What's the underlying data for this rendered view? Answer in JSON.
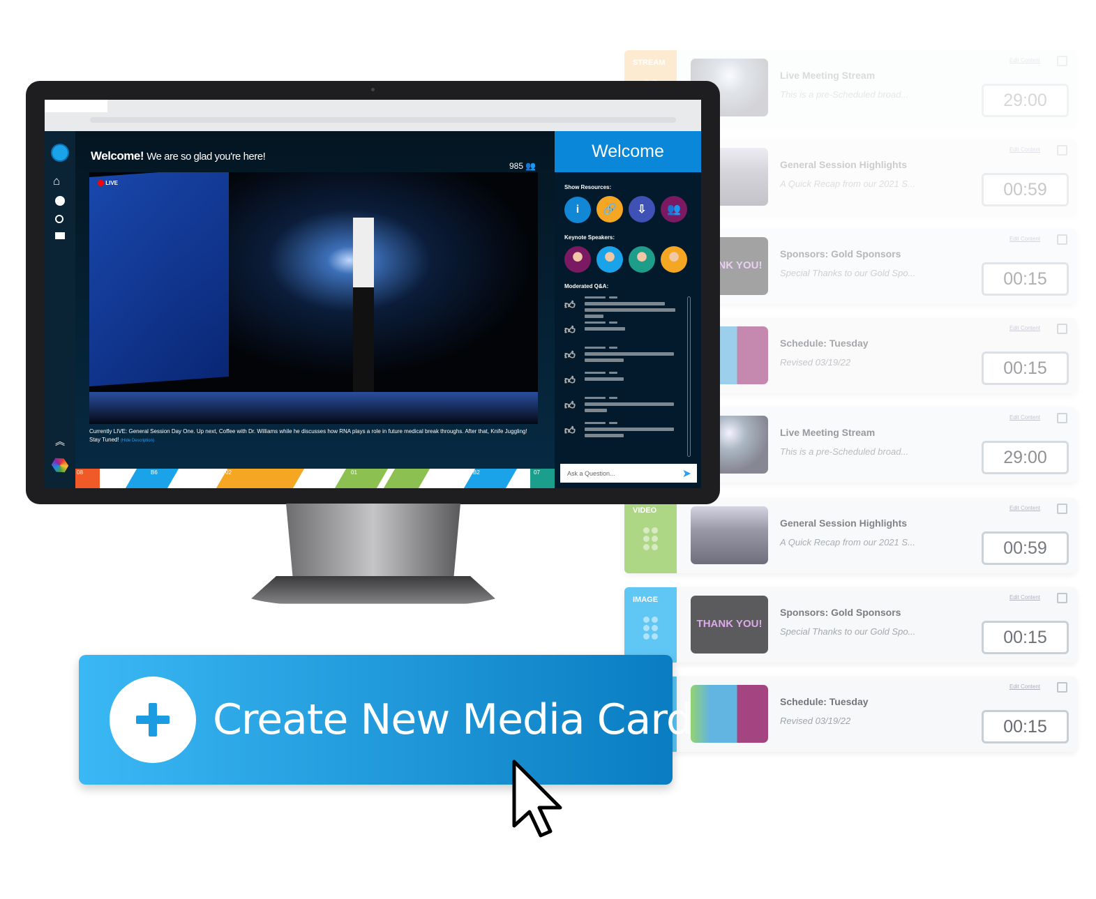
{
  "cards": [
    {
      "type": "STREAM",
      "color": "#f7b24a",
      "title": "Live Meeting Stream",
      "subtitle": "This is a pre-Scheduled broad...",
      "duration": "29:00",
      "edit": "Edit Content",
      "thumb": "stage",
      "opacity": 0.25
    },
    {
      "type": "",
      "color": "#8cc152",
      "title": "General Session Highlights",
      "subtitle": "A Quick Recap from our 2021 S...",
      "duration": "00:59",
      "edit": "Edit Content",
      "thumb": "office",
      "opacity": 0.35
    },
    {
      "type": "",
      "color": "#4fc1f5",
      "title": "Sponsors: Gold Sponsors",
      "subtitle": "Special Thanks to our Gold Spo...",
      "duration": "00:15",
      "edit": "Edit Content",
      "thumb": "thanks",
      "opacity": 0.5
    },
    {
      "type": "",
      "color": "#4fc1f5",
      "title": "Schedule: Tuesday",
      "subtitle": "Revised 03/19/22",
      "duration": "00:15",
      "edit": "Edit Content",
      "thumb": "schedule",
      "opacity": 0.6
    },
    {
      "type": "",
      "color": "#f7b24a",
      "title": "Live Meeting Stream",
      "subtitle": "This is a pre-Scheduled broad...",
      "duration": "29:00",
      "edit": "Edit Content",
      "thumb": "stage",
      "opacity": 0.7
    },
    {
      "type": "VIDEO",
      "color": "#9fd170",
      "title": "General Session Highlights",
      "subtitle": "A Quick Recap from our 2021 S...",
      "duration": "00:59",
      "edit": "Edit Content",
      "thumb": "office",
      "opacity": 0.85
    },
    {
      "type": "IMAGE",
      "color": "#4fc1f5",
      "title": "Sponsors: Gold Sponsors",
      "subtitle": "Special Thanks to our Gold Spo...",
      "duration": "00:15",
      "edit": "Edit Content",
      "thumb": "thanks",
      "opacity": 0.9
    },
    {
      "type": "",
      "color": "#4fc1f5",
      "title": "Schedule: Tuesday",
      "subtitle": "Revised 03/19/22",
      "duration": "00:15",
      "edit": "Edit Content",
      "thumb": "schedule",
      "opacity": 0.95
    }
  ],
  "thanks_text": "THANK YOU!",
  "app": {
    "welcome_bold": "Welcome!",
    "welcome_rest": "We are so glad you're here!",
    "viewers": "985",
    "live": "LIVE",
    "caption": "Currently LIVE: General Session Day One.  Up next, Coffee with Dr. Williams while he discusses how RNA plays a role in future medical break throughs.  After that, Knife Juggling! Stay Tuned!",
    "hide_desc": "(Hide Description)",
    "panel_title": "Welcome",
    "show_resources": "Show Resources:",
    "keynote": "Keynote Speakers:",
    "qa": "Moderated Q&A:",
    "ask_placeholder": "Ask a Question...",
    "resources": [
      {
        "icon": "info-icon",
        "glyph": "i",
        "color": "#1187d6"
      },
      {
        "icon": "link-icon",
        "glyph": "🔗",
        "color": "#f5a623"
      },
      {
        "icon": "file-download-icon",
        "glyph": "⇩",
        "color": "#3f51b5"
      },
      {
        "icon": "users-icon",
        "glyph": "👥",
        "color": "#7b1a63"
      }
    ],
    "speakers": [
      "#7b1a63",
      "#1aa3e8",
      "#1e9d8b",
      "#f5a623"
    ],
    "qa_likes": [
      true,
      true,
      false,
      false,
      true,
      false
    ],
    "strip": [
      "08",
      "B6",
      "02",
      "01",
      "B2",
      "07"
    ]
  },
  "cta": {
    "label": "Create New Media Card",
    "icon": "plus-icon"
  }
}
